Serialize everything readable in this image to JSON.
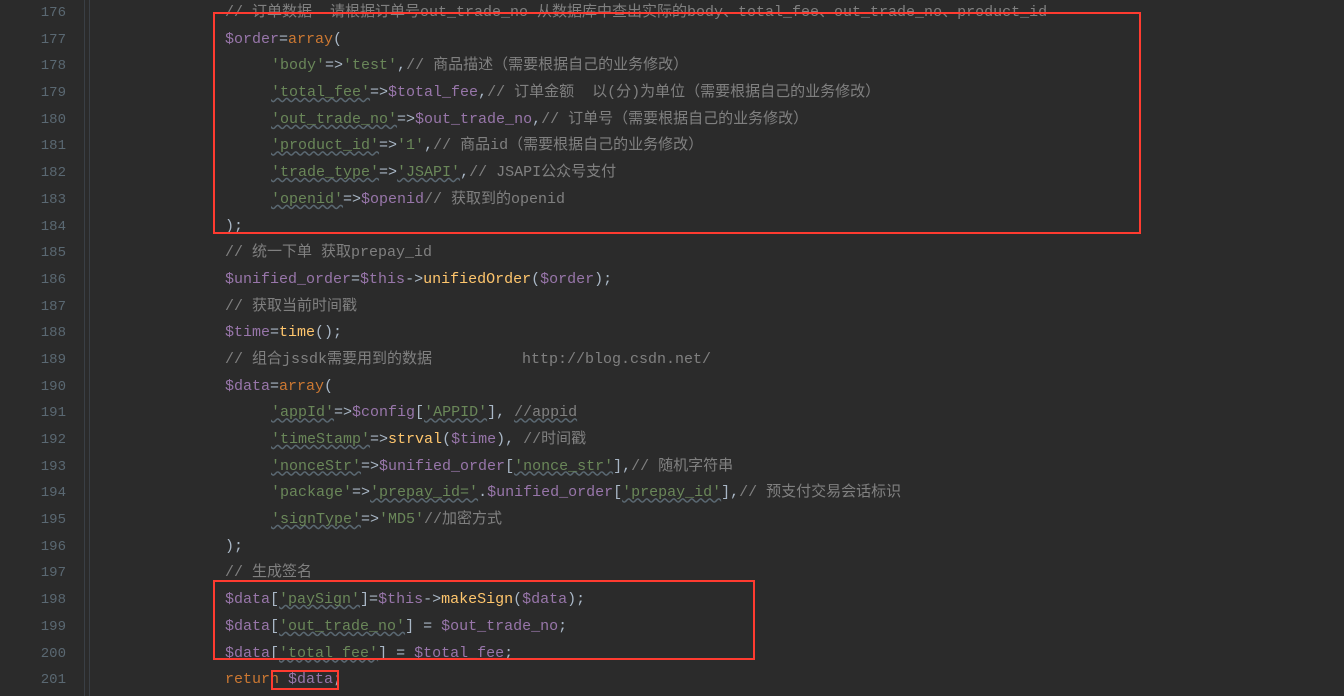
{
  "lines": {
    "176": "176",
    "177": "177",
    "178": "178",
    "179": "179",
    "180": "180",
    "181": "181",
    "182": "182",
    "183": "183",
    "184": "184",
    "185": "185",
    "186": "186",
    "187": "187",
    "188": "188",
    "189": "189",
    "190": "190",
    "191": "191",
    "192": "192",
    "193": "193",
    "194": "194",
    "195": "195",
    "196": "196",
    "197": "197",
    "198": "198",
    "199": "199",
    "200": "200",
    "201": "201"
  },
  "c": {
    "l176": "// 订单数据  请根据订单号out_trade_no 从数据库中查出实际的body、total_fee、out_trade_no、product_id",
    "l177_var": "$order",
    "l177_eq": "=",
    "l177_kw": "array",
    "l177_p": "(",
    "l178_k": "'body'",
    "l178_a": "=>",
    "l178_v": "'test'",
    "l178_c": ",",
    "l178_cm": "// 商品描述（需要根据自己的业务修改）",
    "l179_k": "'total_fee'",
    "l179_a": "=>",
    "l179_v": "$total_fee",
    "l179_c": ",",
    "l179_cm": "// 订单金额  以(分)为单位（需要根据自己的业务修改）",
    "l180_k": "'out_trade_no'",
    "l180_a": "=>",
    "l180_v": "$out_trade_no",
    "l180_c": ",",
    "l180_cm": "// 订单号（需要根据自己的业务修改）",
    "l181_k": "'product_id'",
    "l181_a": "=>",
    "l181_v": "'1'",
    "l181_c": ",",
    "l181_cm": "// 商品id（需要根据自己的业务修改）",
    "l182_k": "'trade_type'",
    "l182_a": "=>",
    "l182_v": "'JSAPI'",
    "l182_c": ",",
    "l182_cm": "// JSAPI公众号支付",
    "l183_k": "'openid'",
    "l183_a": "=>",
    "l183_v": "$openid",
    "l183_cm": "// 获取到的openid",
    "l184": ");",
    "l185": "// 统一下单 获取prepay_id",
    "l186_var": "$unified_order",
    "l186_eq": "=",
    "l186_this": "$this",
    "l186_arrow": "->",
    "l186_fn": "unifiedOrder",
    "l186_p1": "(",
    "l186_arg": "$order",
    "l186_p2": ");",
    "l187": "// 获取当前时间戳",
    "l188_var": "$time",
    "l188_eq": "=",
    "l188_fn": "time",
    "l188_p": "();",
    "l189_a": "// 组合jssdk需要用到的数据          ",
    "l189_b": "http://blog.csdn.net/",
    "l190_var": "$data",
    "l190_eq": "=",
    "l190_kw": "array",
    "l190_p": "(",
    "l191_k": "'appId'",
    "l191_a": "=>",
    "l191_v": "$config",
    "l191_b": "[",
    "l191_s": "'APPID'",
    "l191_b2": "], ",
    "l191_cm": "//appid",
    "l192_k": "'timeStamp'",
    "l192_a": "=>",
    "l192_fn": "strval",
    "l192_p1": "(",
    "l192_v": "$time",
    "l192_p2": "), ",
    "l192_cm": "//时间戳",
    "l193_k": "'nonceStr'",
    "l193_a": "=>",
    "l193_v": "$unified_order",
    "l193_b": "[",
    "l193_s": "'nonce_str'",
    "l193_b2": "],",
    "l193_cm": "// 随机字符串",
    "l194_k": "'package'",
    "l194_a": "=>",
    "l194_v1": "'prepay_id='",
    "l194_dot": ".",
    "l194_v2": "$unified_order",
    "l194_b": "[",
    "l194_s": "'prepay_id'",
    "l194_b2": "],",
    "l194_cm": "// 预支付交易会话标识",
    "l195_k": "'signType'",
    "l195_a": "=>",
    "l195_v": "'MD5'",
    "l195_cm": "//加密方式",
    "l196": ");",
    "l197": "// 生成签名",
    "l198_var": "$data",
    "l198_b": "[",
    "l198_s": "'paySign'",
    "l198_b2": "]=",
    "l198_this": "$this",
    "l198_arrow": "->",
    "l198_fn": "makeSign",
    "l198_p1": "(",
    "l198_arg": "$data",
    "l198_p2": ");",
    "l199_var": "$data",
    "l199_b": "[",
    "l199_s": "'out_trade_no'",
    "l199_b2": "] = ",
    "l199_v": "$out_trade_no",
    "l199_e": ";",
    "l200_var": "$data",
    "l200_b": "[",
    "l200_s": "'total_fee'",
    "l200_b2": "] = ",
    "l200_v": "$total_fee",
    "l200_e": ";",
    "l201_kw": "return ",
    "l201_var": "$data",
    "l201_e": ";"
  }
}
